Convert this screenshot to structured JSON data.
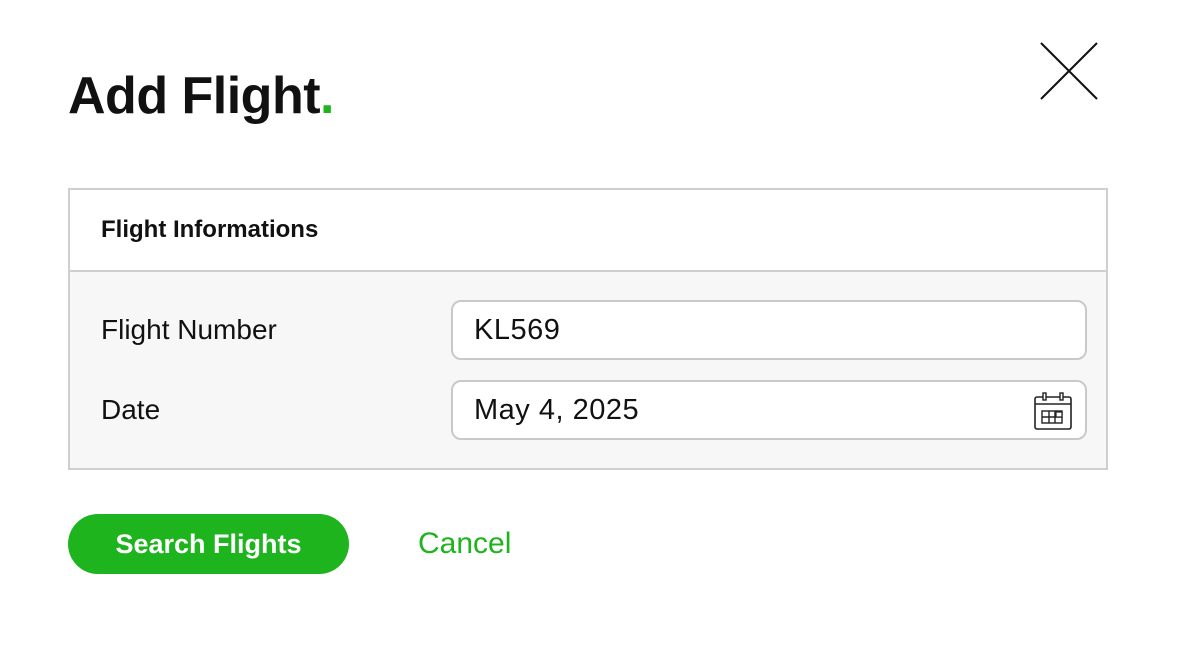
{
  "dialog": {
    "title": "Add Flight",
    "title_dot": ".",
    "close_icon": "close-icon",
    "accent_color": "#1db41d"
  },
  "panel": {
    "header": "Flight Informations",
    "fields": [
      {
        "label": "Flight Number",
        "value": "KL569"
      },
      {
        "label": "Date",
        "value": "May 4, 2025",
        "icon": "calendar-icon"
      }
    ]
  },
  "actions": {
    "primary_label": "Search Flights",
    "cancel_label": "Cancel"
  }
}
